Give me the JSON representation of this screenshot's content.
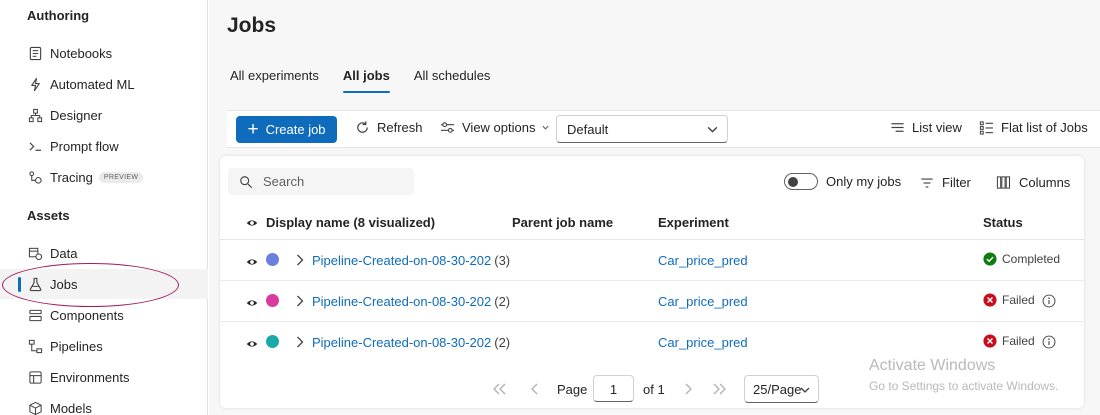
{
  "sidebar": {
    "authoring_title": "Authoring",
    "assets_title": "Assets",
    "items": [
      {
        "label": "Notebooks",
        "icon": "notebook-icon"
      },
      {
        "label": "Automated ML",
        "icon": "automl-icon"
      },
      {
        "label": "Designer",
        "icon": "designer-icon"
      },
      {
        "label": "Prompt flow",
        "icon": "prompt-flow-icon"
      },
      {
        "label": "Tracing",
        "icon": "tracing-icon",
        "badge": "PREVIEW"
      },
      {
        "label": "Data",
        "icon": "data-icon"
      },
      {
        "label": "Jobs",
        "icon": "flask-icon",
        "active": true
      },
      {
        "label": "Components",
        "icon": "components-icon"
      },
      {
        "label": "Pipelines",
        "icon": "pipelines-icon"
      },
      {
        "label": "Environments",
        "icon": "environments-icon"
      },
      {
        "label": "Models",
        "icon": "models-icon"
      }
    ]
  },
  "page": {
    "title": "Jobs"
  },
  "tabs": [
    {
      "label": "All experiments",
      "active": false
    },
    {
      "label": "All jobs",
      "active": true
    },
    {
      "label": "All schedules",
      "active": false
    }
  ],
  "toolbar": {
    "create_job": "Create job",
    "refresh": "Refresh",
    "view_options": "View options",
    "view_select": "Default",
    "list_view": "List view",
    "flat_list": "Flat list of Jobs"
  },
  "panel": {
    "search_placeholder": "Search",
    "only_my_jobs": "Only my jobs",
    "filter": "Filter",
    "columns": "Columns"
  },
  "table": {
    "headers": {
      "display_name": "Display name (8 visualized)",
      "parent_job": "Parent job name",
      "experiment": "Experiment",
      "status": "Status"
    },
    "rows": [
      {
        "name": "Pipeline-Created-on-08-30-202",
        "count": "(3)",
        "experiment": "Car_price_pred",
        "status": "Completed",
        "color": "#6b7fe0"
      },
      {
        "name": "Pipeline-Created-on-08-30-202",
        "count": "(2)",
        "experiment": "Car_price_pred",
        "status": "Failed",
        "color": "#d93aa0"
      },
      {
        "name": "Pipeline-Created-on-08-30-202",
        "count": "(2)",
        "experiment": "Car_price_pred",
        "status": "Failed",
        "color": "#1aa8a8"
      }
    ]
  },
  "pager": {
    "page_label": "Page",
    "current_page": "1",
    "of_label": "of 1",
    "per_page": "25/Page"
  },
  "watermark": {
    "line1": "Activate Windows",
    "line2": "Go to Settings to activate Windows."
  },
  "colors": {
    "accent": "#0f6cbd",
    "success": "#107c10",
    "error": "#c50f1f",
    "highlight_ellipse": "#a2185f"
  }
}
